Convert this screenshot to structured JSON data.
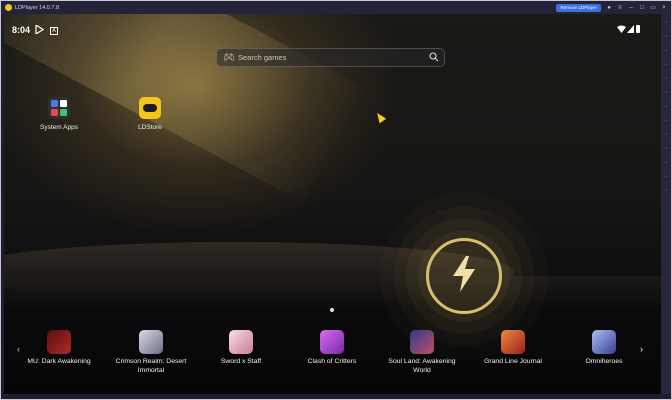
{
  "titlebar": {
    "app_title": "LDPlayer 14.0.7.8",
    "remove_button": "Remove LDPlayer"
  },
  "status": {
    "time": "8:04"
  },
  "search": {
    "placeholder": "Search games"
  },
  "desktop": {
    "icons": [
      {
        "label": "System Apps"
      },
      {
        "label": "LDStore"
      }
    ]
  },
  "games": [
    {
      "label": "MU: Dark Awakening",
      "color": "#b02a2a"
    },
    {
      "label": "Crimson Realm: Desert Immortal",
      "color": "#9a9cb0"
    },
    {
      "label": "Sword x Staff",
      "color": "#e9b8c6"
    },
    {
      "label": "Clash of Critters",
      "color": "#b348d8"
    },
    {
      "label": "Soul Land: Awakening World",
      "color": "#3c5bb8"
    },
    {
      "label": "Grand Line Journal",
      "color": "#c8402e"
    },
    {
      "label": "Omniheroes",
      "color": "#6d7fd6"
    }
  ],
  "colors": {
    "accent": "#f5c518",
    "remove_button": "#3c6fe0"
  }
}
